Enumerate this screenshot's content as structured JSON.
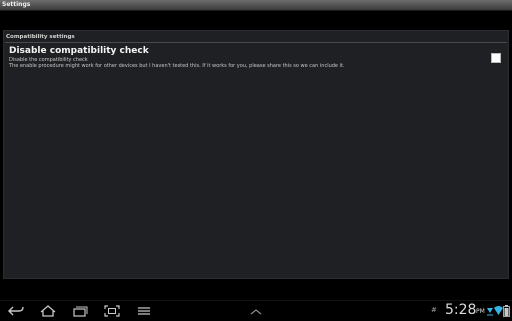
{
  "window": {
    "title": "Settings"
  },
  "section": {
    "header": "Compatibility settings"
  },
  "preference": {
    "title": "Disable compatibility check",
    "summary": "Disable the compatibility check",
    "detail": "The enable procedure might work for other devices but I haven't tested this. If it works for you, please share this so we can include it.",
    "checked": false
  },
  "navbar": {
    "buttons": [
      "back-icon",
      "home-icon",
      "recent-apps-icon",
      "screenshot-icon",
      "menu-icon",
      "chevron-up-icon"
    ]
  },
  "status": {
    "indicator": "#",
    "time": "5:28",
    "ampm": "PM",
    "icons": [
      "download-icon",
      "wifi-icon",
      "battery-icon"
    ]
  },
  "colors": {
    "background": "#000000",
    "panel": "#1f2023",
    "accent": "#33b5e5",
    "checkbox": "#ffffff"
  }
}
